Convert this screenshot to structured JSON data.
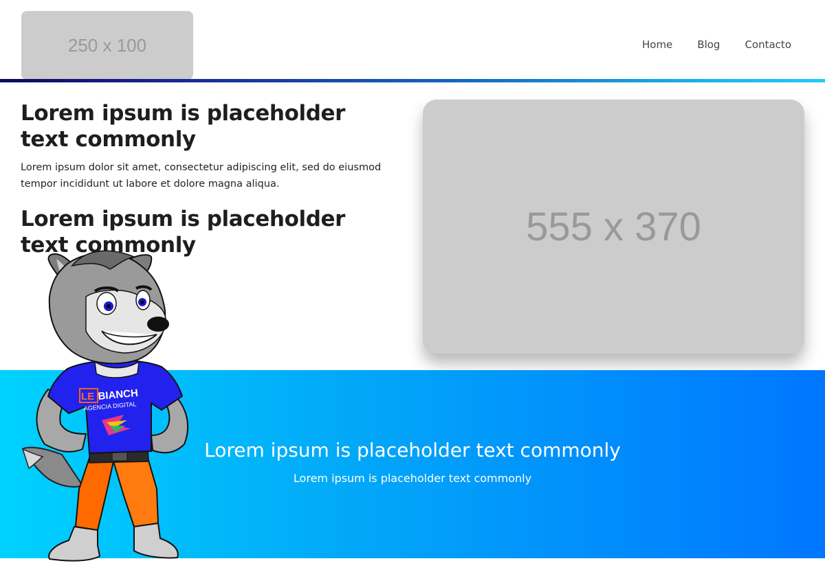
{
  "header": {
    "logo_placeholder": "250 x 100",
    "nav": [
      "Home",
      "Blog",
      "Contacto"
    ]
  },
  "hero": {
    "heading_1": "Lorem ipsum is placeholder text commonly",
    "paragraph": "Lorem ipsum dolor sit amet, consectetur adipiscing elit, sed do eiusmod tempor incididunt ut labore et dolore magna aliqua.",
    "heading_2": "Lorem ipsum is placeholder text commonly",
    "image_placeholder": "555 x 370"
  },
  "banner": {
    "title": "Lorem ipsum is placeholder text commonly",
    "subtitle": "Lorem ipsum is placeholder text commonly"
  },
  "mascot": {
    "shirt_brand_le": "LE",
    "shirt_brand_rest": "BIANCH",
    "shirt_tagline": "AGENCIA DIGITAL"
  },
  "colors": {
    "banner_start": "#00d2ff",
    "banner_end": "#0076ff",
    "accent_dark": "#0b0a5c",
    "placeholder_bg": "#cccccc"
  }
}
